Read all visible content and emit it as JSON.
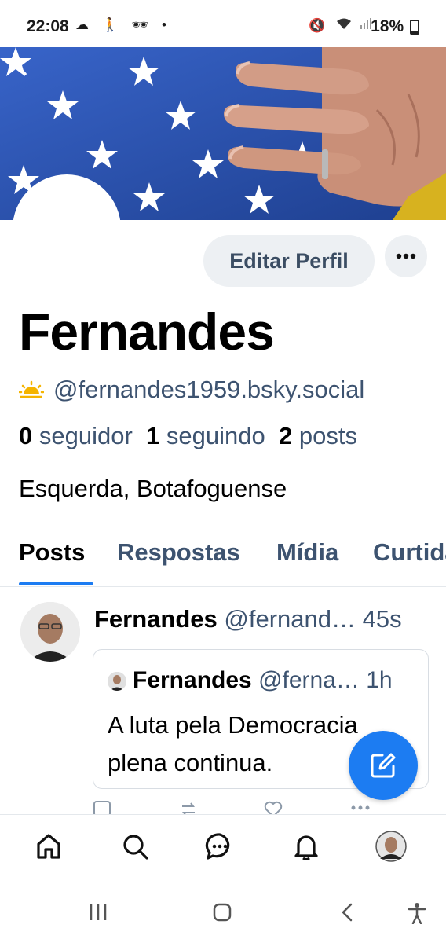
{
  "status_bar": {
    "time": "22:08",
    "battery": "18%",
    "left_icons": [
      "cloud-icon",
      "walking-icon",
      "incognito-icon",
      "dot-icon"
    ],
    "right_icons": [
      "mute-icon",
      "wifi-icon",
      "signal-icon",
      "battery-icon"
    ]
  },
  "profile": {
    "name": "Fernandes",
    "handle": "@fernandes1959.bsky.social",
    "followers_count": "0",
    "followers_label": "seguidor",
    "following_count": "1",
    "following_label": "seguindo",
    "posts_count": "2",
    "posts_label": "posts",
    "bio": "Esquerda, Botafoguense",
    "edit_label": "Editar Perfil"
  },
  "tabs": [
    {
      "label": "Posts",
      "active": true
    },
    {
      "label": "Respostas",
      "active": false
    },
    {
      "label": "Mídia",
      "active": false
    },
    {
      "label": "Curtidas",
      "active": false
    }
  ],
  "post": {
    "author": "Fernandes",
    "handle": "@fernand…",
    "time": "45s",
    "quote": {
      "author": "Fernandes",
      "handle": "@ferna…",
      "time": "1h",
      "text": "A luta pela Democracia plena continua."
    }
  },
  "colors": {
    "accent": "#1c7cf2",
    "secondary_text": "#3d5370",
    "button_bg": "#edf0f3",
    "banner_blue": "#2a4ea6"
  }
}
